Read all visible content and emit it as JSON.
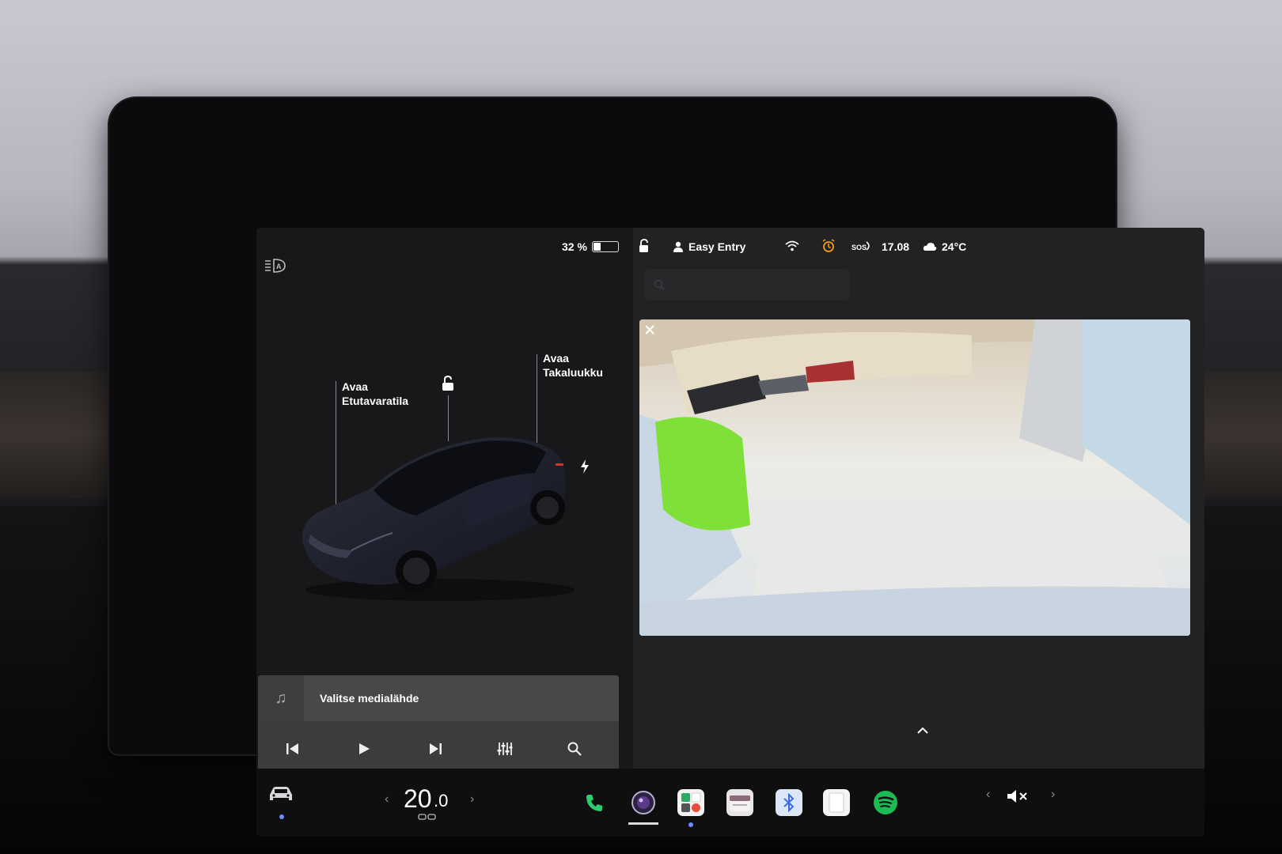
{
  "status_bar": {
    "battery_percent": "32 %",
    "battery_level": 0.32,
    "profile_name": "Easy Entry",
    "time": "17.08",
    "temperature": "24°C",
    "icons": [
      "lock-icon",
      "person-icon",
      "wifi-icon",
      "alarm-icon",
      "sos-icon",
      "cloud-icon"
    ]
  },
  "car_panel": {
    "frunk_label_line1": "Avaa",
    "frunk_label_line2": "Etutavaratila",
    "trunk_label_line1": "Avaa",
    "trunk_label_line2": "Takaluukku"
  },
  "media_player": {
    "source_label": "Valitse medialähde",
    "controls": [
      "previous-icon",
      "play-icon",
      "next-icon",
      "equalizer-icon",
      "search-icon"
    ]
  },
  "dock": {
    "temperature_whole": "20",
    "temperature_decimal": ".0",
    "apps": [
      "phone-icon",
      "camera-app-icon",
      "toybox-icon",
      "calendar-icon",
      "bluetooth-icon",
      "notes-icon",
      "spotify-icon"
    ],
    "volume_state": "muted"
  },
  "colors": {
    "screen_bg": "#1c1c1e",
    "accent_blue": "#3e6ae1",
    "phone_green": "#2ecc71",
    "spotify_green": "#1db954"
  }
}
